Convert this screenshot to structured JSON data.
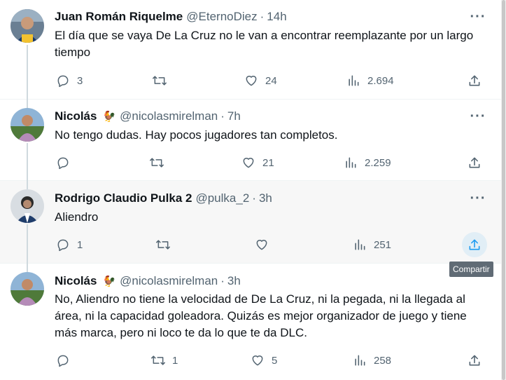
{
  "colors": {
    "accent": "#1d9bf0",
    "muted": "#536471",
    "text": "#0f1419",
    "hover_bg": "#f7f7f7"
  },
  "tweets": [
    {
      "name": "Juan Román Riquelme",
      "handle": "@EternoDiez",
      "separator": "·",
      "time": "14h",
      "text": "El día que se vaya De La Cruz no le van a encontrar reemplazante por un largo tiempo",
      "replies": "3",
      "retweets": "",
      "likes": "24",
      "views": "2.694"
    },
    {
      "name": "Nicolás",
      "emoji": "🐓",
      "handle": "@nicolasmirelman",
      "separator": "·",
      "time": "7h",
      "text": "No tengo dudas. Hay pocos jugadores tan completos.",
      "replies": "",
      "retweets": "",
      "likes": "21",
      "views": "2.259"
    },
    {
      "name": "Rodrigo Claudio Pulka 2",
      "handle": "@pulka_2",
      "separator": "·",
      "time": "3h",
      "text": "Aliendro",
      "replies": "1",
      "retweets": "",
      "likes": "",
      "views": "251"
    },
    {
      "name": "Nicolás",
      "emoji": "🐓",
      "handle": "@nicolasmirelman",
      "separator": "·",
      "time": "3h",
      "text": "No, Aliendro no tiene la velocidad de De La Cruz, ni la pegada, ni la llegada al área, ni la capacidad goleadora. Quizás es mejor organizador de juego y tiene más marca, pero ni loco te da lo que te da DLC.",
      "replies": "",
      "retweets": "1",
      "likes": "5",
      "views": "258"
    }
  ],
  "more_label": "···",
  "tooltip": {
    "text": "Compartir"
  },
  "icons": [
    "reply-icon",
    "retweet-icon",
    "like-icon",
    "views-icon",
    "share-icon",
    "more-icon"
  ]
}
